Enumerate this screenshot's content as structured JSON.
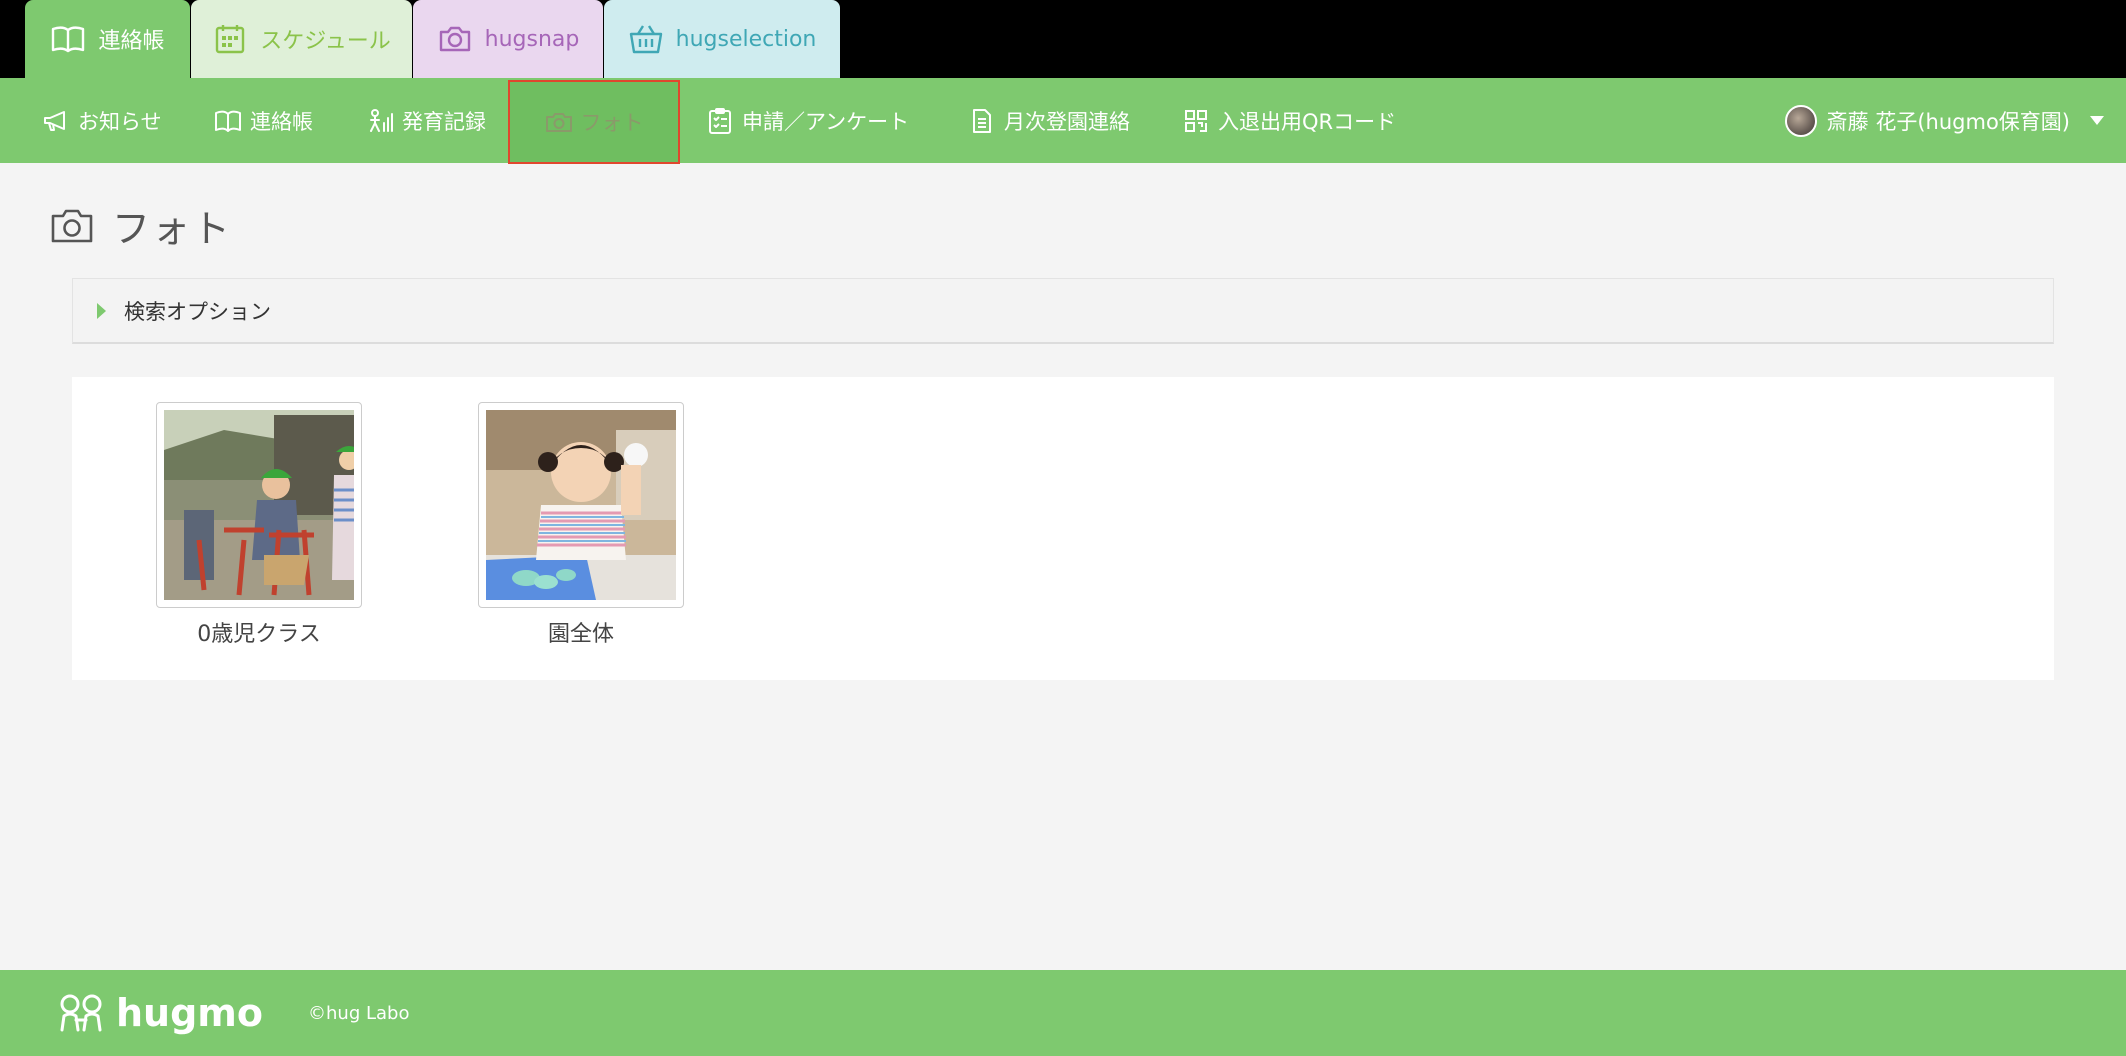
{
  "app_tabs": [
    {
      "label": "連絡帳",
      "icon": "notebook-icon"
    },
    {
      "label": "スケジュール",
      "icon": "calendar-icon"
    },
    {
      "label": "hugsnap",
      "icon": "camera-icon"
    },
    {
      "label": "hugselection",
      "icon": "basket-icon"
    }
  ],
  "nav": {
    "items": [
      {
        "label": "お知らせ",
        "icon": "megaphone-icon"
      },
      {
        "label": "連絡帳",
        "icon": "notebook-icon"
      },
      {
        "label": "発育記録",
        "icon": "growth-chart-icon"
      },
      {
        "label": "フォト",
        "icon": "camera-icon",
        "active": true
      },
      {
        "label": "申請／アンケート",
        "icon": "clipboard-icon"
      },
      {
        "label": "月次登園連絡",
        "icon": "document-icon"
      },
      {
        "label": "入退出用QRコード",
        "icon": "qr-code-icon"
      }
    ],
    "user_name": "斎藤 花子(hugmo保育園)"
  },
  "page": {
    "title": "フォト",
    "title_icon": "camera-icon"
  },
  "search": {
    "label": "検索オプション"
  },
  "albums": [
    {
      "label": "0歳児クラス"
    },
    {
      "label": "園全体"
    }
  ],
  "footer": {
    "logo_text": "hugmo",
    "copyright": "©hug Labo"
  },
  "colors": {
    "brand_green": "#7ec96f",
    "active_outline": "#e0472e",
    "schedule_tab": "#dff0d8",
    "hugsnap_tab": "#ead7ef",
    "hugselection_tab": "#cfecef"
  }
}
